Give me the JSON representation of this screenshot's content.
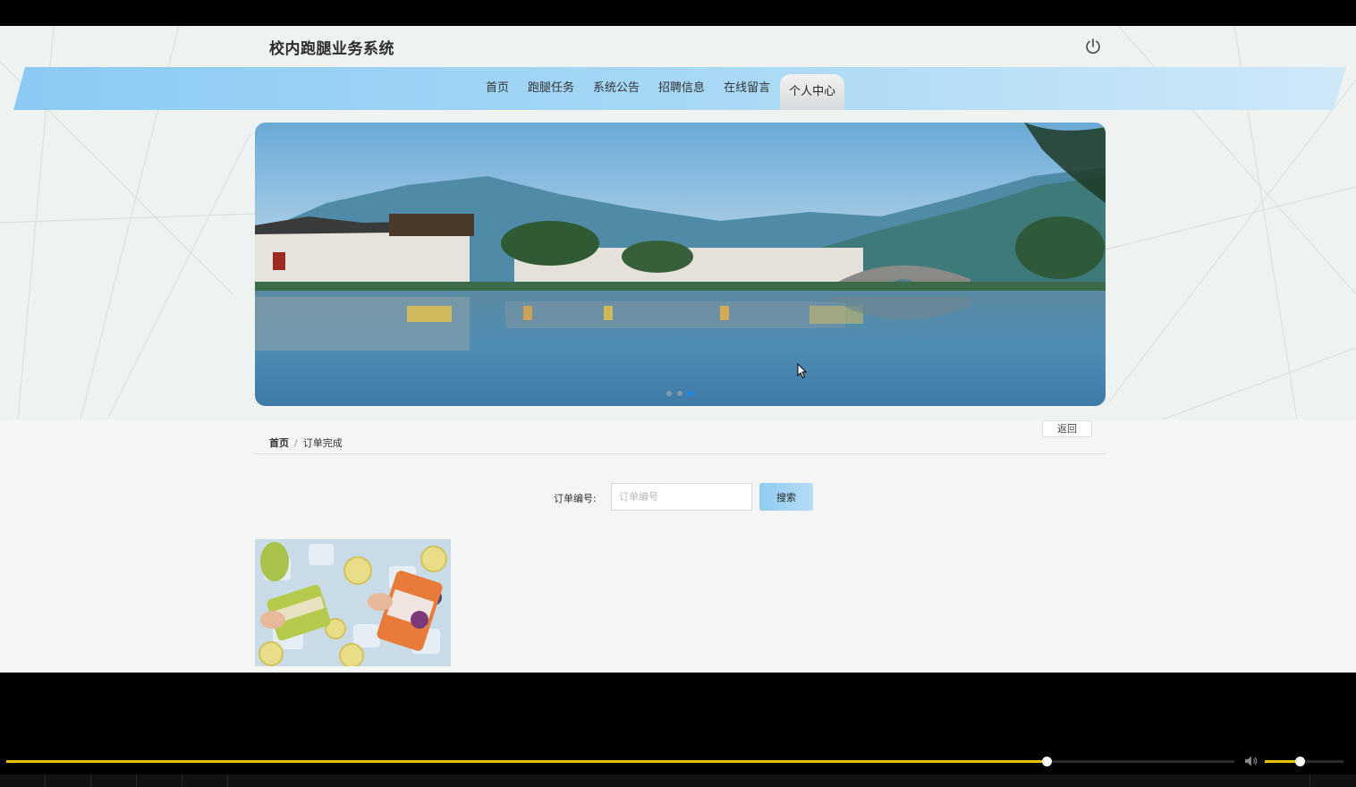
{
  "header": {
    "site_title": "校内跑腿业务系统",
    "power_icon": "power-icon"
  },
  "nav": {
    "items": [
      {
        "label": "首页",
        "active": false
      },
      {
        "label": "跑腿任务",
        "active": false
      },
      {
        "label": "系统公告",
        "active": false
      },
      {
        "label": "招聘信息",
        "active": false
      },
      {
        "label": "在线留言",
        "active": false
      },
      {
        "label": "个人中心",
        "active": true
      }
    ]
  },
  "banner": {
    "slide_count": 3,
    "active_slide": 3
  },
  "breadcrumb": {
    "home": "首页",
    "separator": "/",
    "current": "订单完成"
  },
  "back_button": "返回",
  "search": {
    "label": "订单编号:",
    "value": "",
    "placeholder": "订单编号",
    "button": "搜索"
  },
  "player": {
    "progress_fraction": 0.847,
    "volume_fraction": 0.44,
    "volume_icon": "speaker-icon",
    "accent_color": "#e8c000"
  },
  "colors": {
    "nav_band": "#9fd3f5",
    "search_button": "#8fccf1"
  }
}
